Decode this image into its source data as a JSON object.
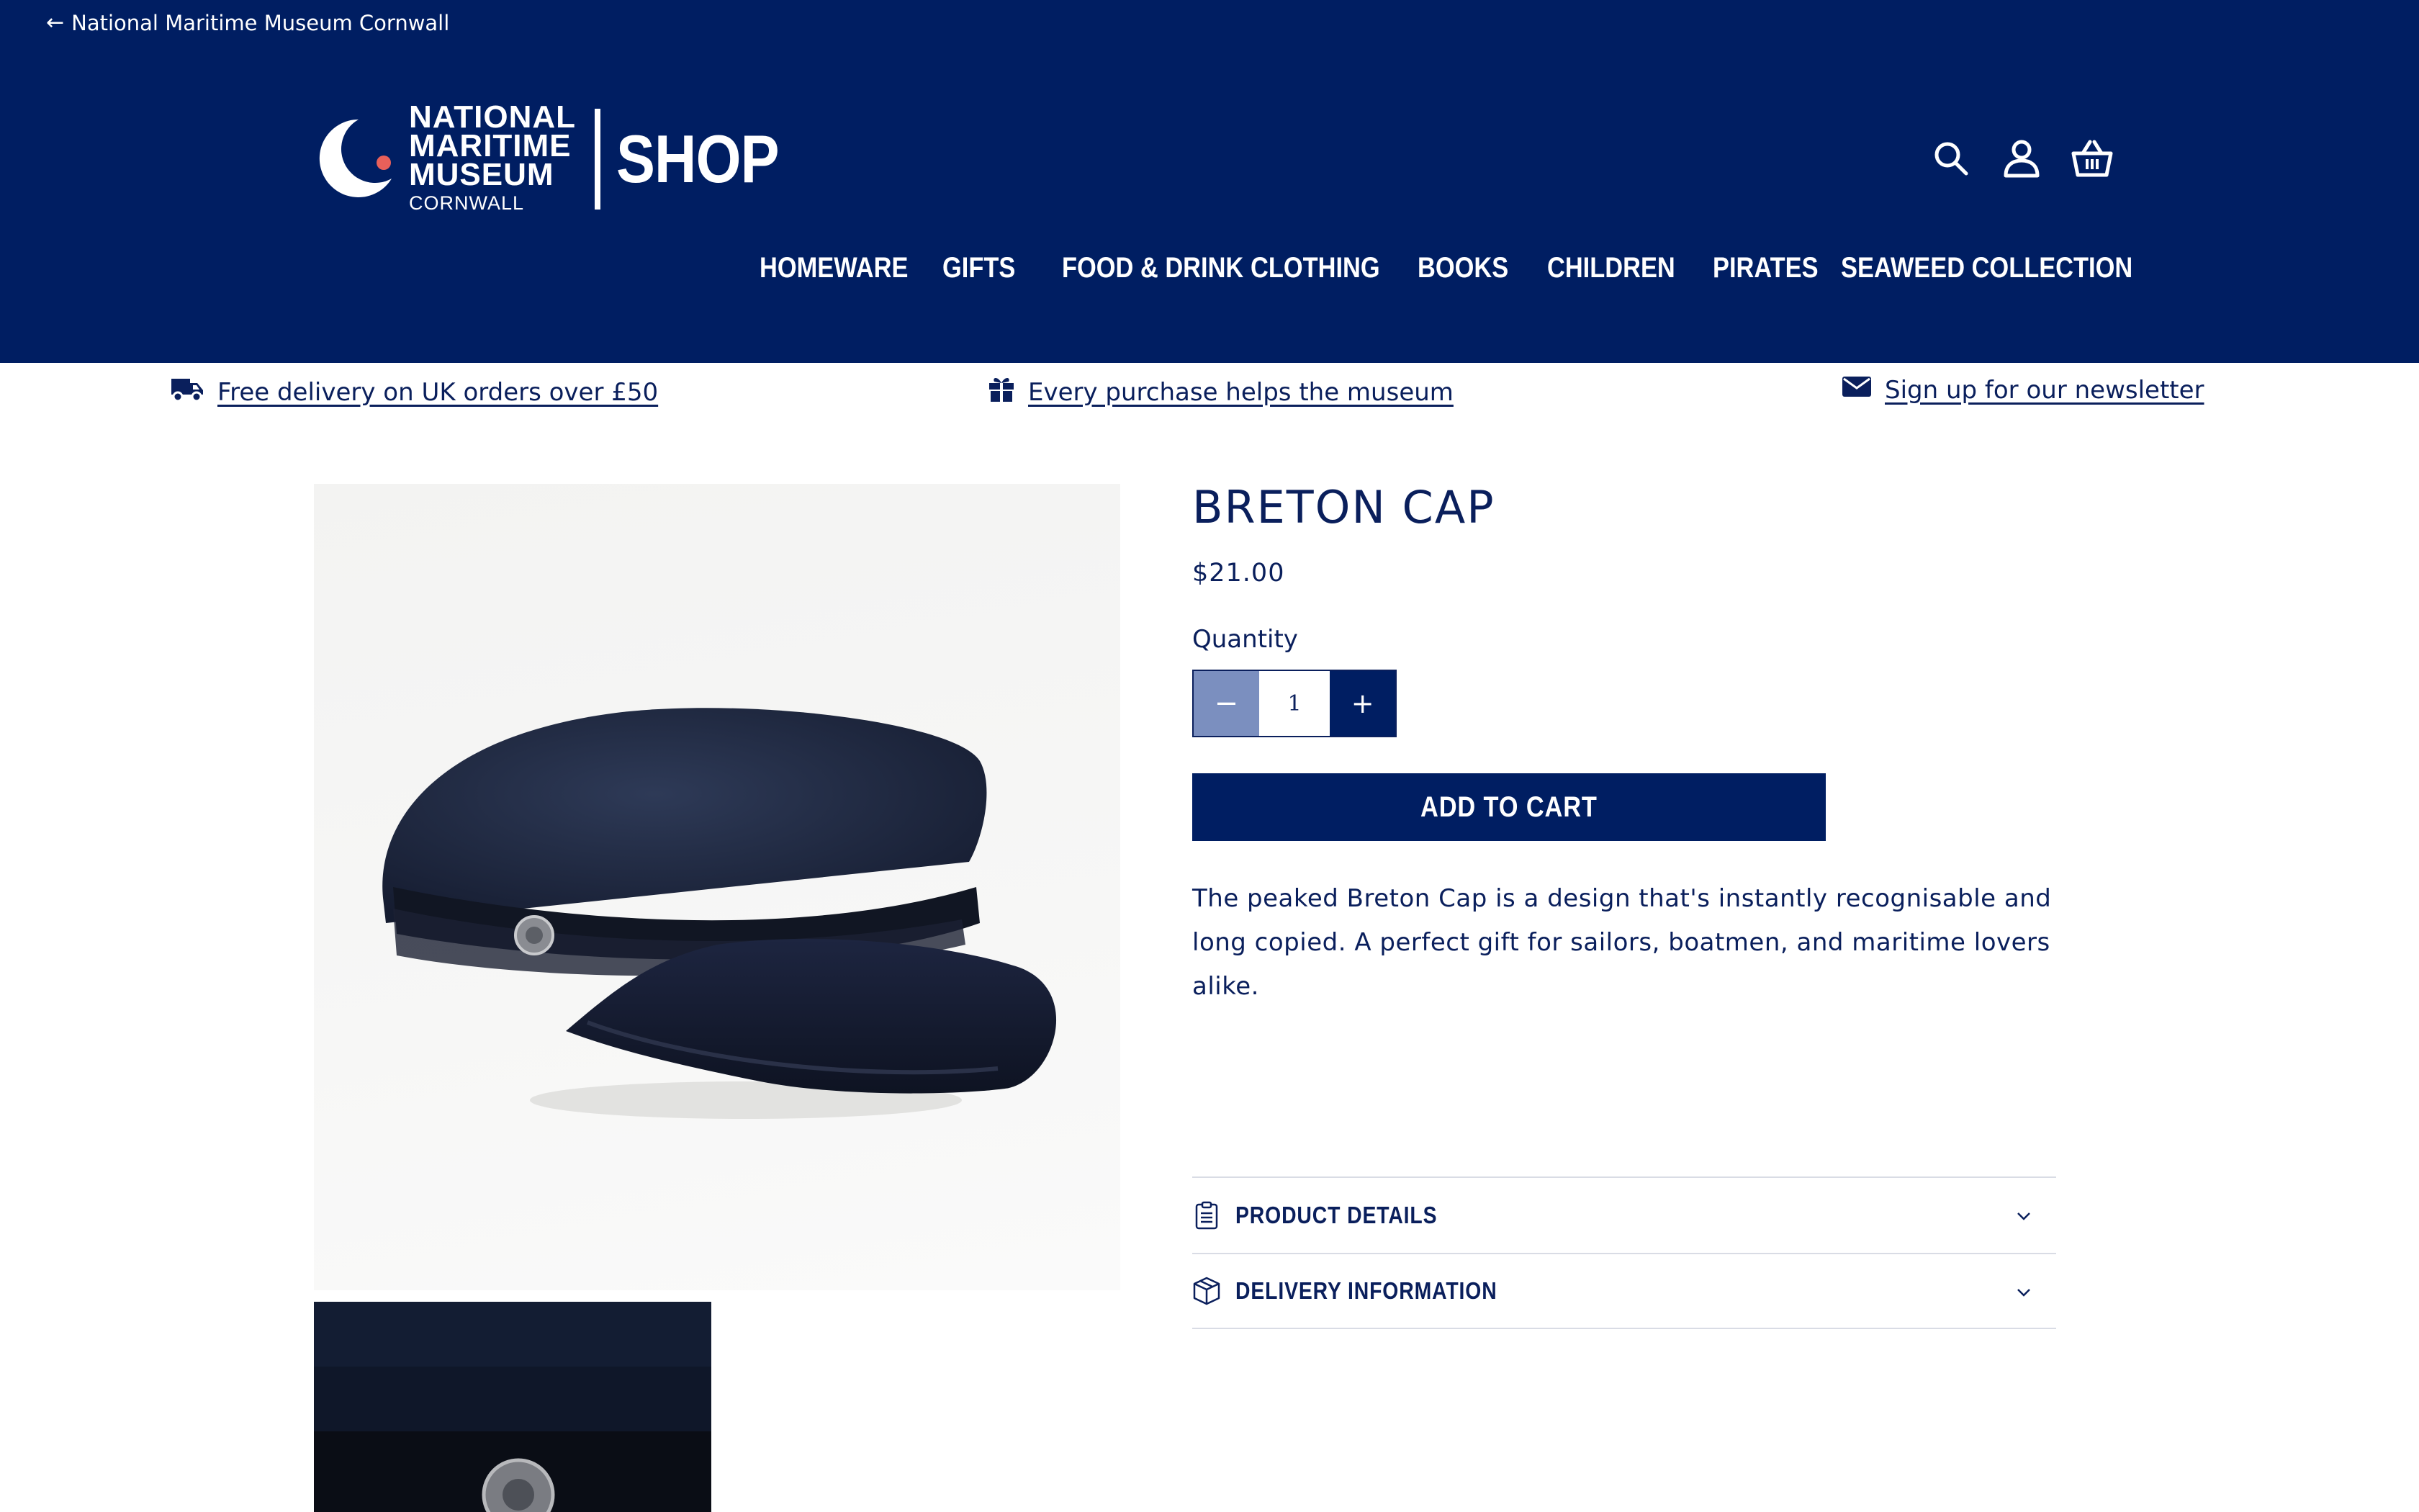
{
  "topbar": {
    "back_link": "National Maritime Museum Cornwall"
  },
  "logo": {
    "line1": "NATIONAL",
    "line2": "MARITIME",
    "line3": "MUSEUM",
    "line4": "CORNWALL",
    "shop": "SHOP"
  },
  "header_icons": [
    "search-icon",
    "account-icon",
    "basket-icon"
  ],
  "nav": {
    "items": [
      {
        "label": "HOMEWARE"
      },
      {
        "label": "GIFTS"
      },
      {
        "label": "FOOD & DRINK"
      },
      {
        "label": "CLOTHING"
      },
      {
        "label": "BOOKS"
      },
      {
        "label": "CHILDREN"
      },
      {
        "label": "PIRATES"
      },
      {
        "label": "SEAWEED COLLECTION"
      }
    ]
  },
  "announcements": {
    "delivery": "Free delivery on UK orders over £50",
    "museum": "Every purchase helps the museum",
    "newsletter": "Sign up for our newsletter"
  },
  "product": {
    "title": "BRETON CAP",
    "price": "$21.00",
    "quantity_label": "Quantity",
    "quantity_value": "1",
    "minus": "−",
    "plus": "+",
    "add_to_cart": "ADD TO CART",
    "description": "The peaked Breton Cap is a design that's instantly recognisable and long copied. A perfect gift for sailors, boatmen, and maritime lovers alike."
  },
  "accordion": {
    "product_details": "PRODUCT DETAILS",
    "delivery_information": "DELIVERY INFORMATION"
  },
  "colors": {
    "brand_navy": "#001e62",
    "text_navy": "#0a1f5c",
    "minus_button": "#7b8fbf",
    "logo_dot": "#e8605a"
  }
}
